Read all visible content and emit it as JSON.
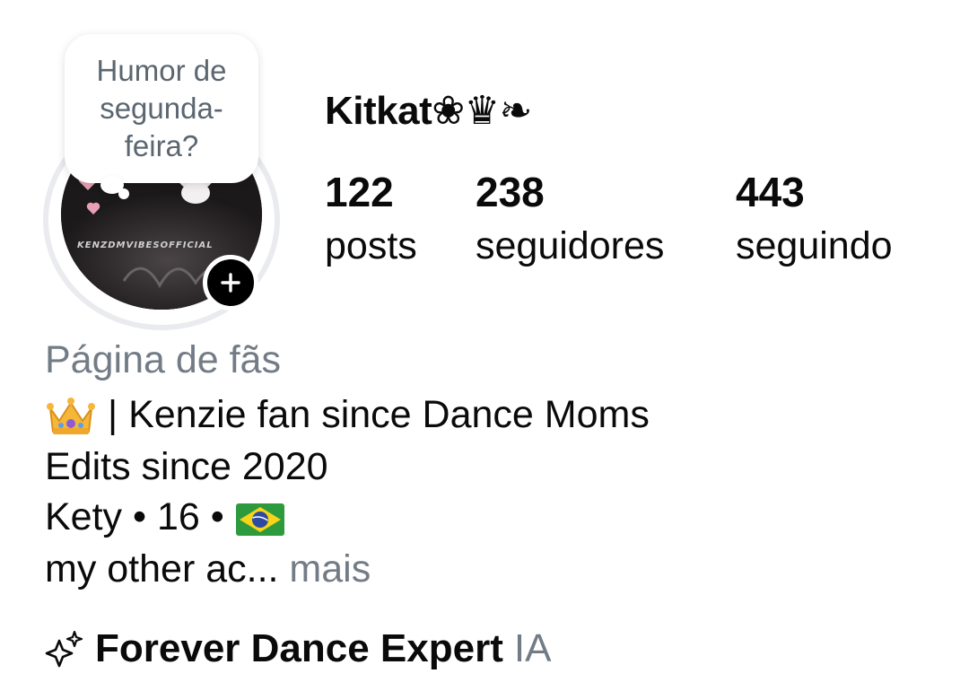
{
  "profile": {
    "username": "Kitkat❀♛❧",
    "note": "Humor de segunda-feira?",
    "avatar_watermark": "KENZDMVIBESOFFICIAL",
    "avatar_icon": "profile-photo",
    "add_story_icon": "plus-icon"
  },
  "stats": {
    "posts": {
      "count": "122",
      "label": "posts"
    },
    "followers": {
      "count": "238",
      "label": "seguidores"
    },
    "following": {
      "count": "443",
      "label": "seguindo"
    }
  },
  "bio": {
    "category": "Página de fãs",
    "line1_emoji": "crown",
    "line1_text": " | Kenzie fan since Dance Moms",
    "line2_text": "Edits since 2020",
    "line3_text": "Kety • 16 • ",
    "line3_flag": "brazil-flag",
    "line4_text": "my other ac...",
    "more_label": " mais"
  },
  "ai": {
    "icon": "sparkle-icon",
    "name": "Forever Dance Expert",
    "badge": "IA"
  },
  "colors": {
    "text": "#0a0a0a",
    "muted": "#737c86",
    "note_text": "#5b6670",
    "ring": "#e9ebee",
    "background": "#ffffff"
  }
}
